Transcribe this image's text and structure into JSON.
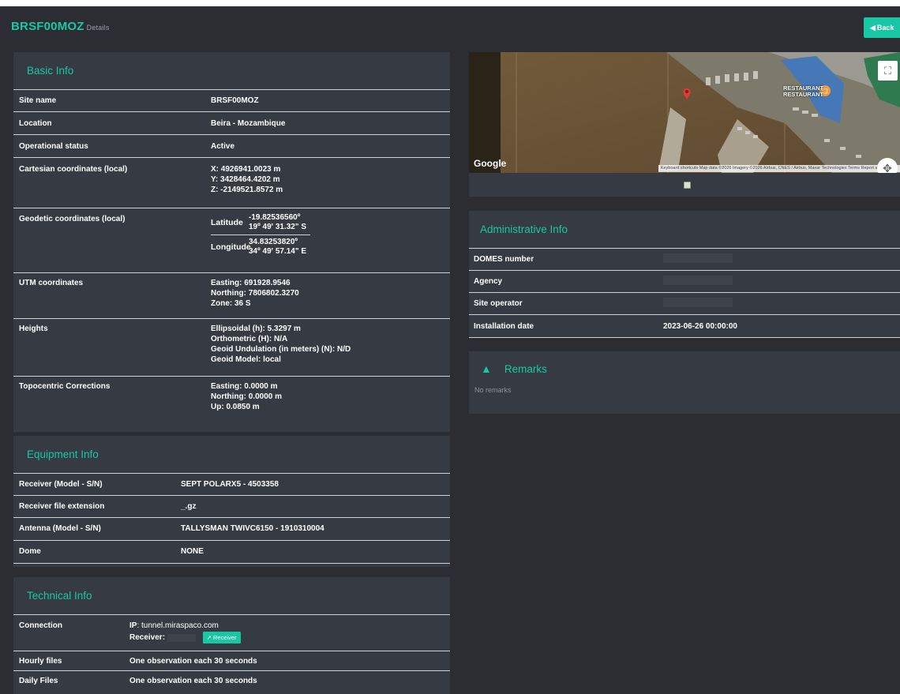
{
  "header": {
    "site_code": "BRSF00MOZ",
    "subtitle": "Details",
    "back_label": "Back"
  },
  "basic_info": {
    "title": "Basic Info",
    "site_name_label": "Site name",
    "site_name": "BRSF00MOZ",
    "location_label": "Location",
    "location": "Beira - Mozambique",
    "status_label": "Operational status",
    "status": "Active",
    "cartesian_label": "Cartesian coordinates (local)",
    "cartesian_x": "X: 4926941.0023 m",
    "cartesian_y": "Y: 3428464.4202 m",
    "cartesian_z": "Z: -2149521.8572 m",
    "geodetic_label": "Geodetic coordinates (local)",
    "latitude_label": "Latitude",
    "latitude_dec": "-19.82536560º",
    "latitude_dms": "19º 49' 31.32\" S",
    "longitude_label": "Longitude",
    "longitude_dec": "34.83253820º",
    "longitude_dms": "34º 49' 57.14\" E",
    "utm_label": "UTM coordinates",
    "utm_easting": "Easting: 691928.9546",
    "utm_northing": "Northing: 7806802.3270",
    "utm_zone": "Zone: 36 S",
    "heights_label": "Heights",
    "h_ellipsoidal": "Ellipsoidal (h): 5.3297 m",
    "h_orthometric": "Orthometric (H): N/A",
    "h_geoid_undulation": "Geoid Undulation (in meters) (N): N/D",
    "h_geoid_model": "Geoid Model: local",
    "topo_label": "Topocentric Corrections",
    "topo_easting": "Easting: 0.0000 m",
    "topo_northing": "Northing: 0.0000 m",
    "topo_up": "Up: 0.0850 m"
  },
  "equipment_info": {
    "title": "Equipment Info",
    "rows": [
      {
        "label": "Receiver (Model - S/N)",
        "value": "SEPT POLARX5 - 4503358"
      },
      {
        "label": "Receiver file extension",
        "value": "_.gz"
      },
      {
        "label": "Antenna (Model - S/N)",
        "value": "TALLYSMAN TWIVC6150 - 1910310004"
      },
      {
        "label": "Dome",
        "value": "NONE"
      }
    ]
  },
  "technical_info": {
    "title": "Technical Info",
    "connection_label": "Connection",
    "ip_label": "IP",
    "ip_value": ": tunnel.miraspaco.com",
    "receiver_label": "Receiver:",
    "receiver_button": "Receiver",
    "hourly_label": "Hourly files",
    "hourly_value": "One observation each 30 seconds",
    "daily_label": "Daily Files",
    "daily_value": "One observation each 30 seconds"
  },
  "map": {
    "provider": "Google",
    "attribution": "Keyboard shortcuts   Map data ©2026 Imagery ©2026 Airbus, CNES / Airbus, Maxar Technologies   Terms   Report a map error",
    "poi_label": "RESTAURANT",
    "poi_label_2": "RESTAURANT"
  },
  "administrative_info": {
    "title": "Administrative Info",
    "domes_label": "DOMES number",
    "agency_label": "Agency",
    "operator_label": "Site operator",
    "installation_label": "Installation date",
    "installation_date": "2023-06-26 00:00:00"
  },
  "remarks": {
    "title": "Remarks",
    "empty_text": "No remarks"
  },
  "colors": {
    "accent": "#19c7a5",
    "background": "#2b2d33",
    "panel": "#363a42"
  }
}
